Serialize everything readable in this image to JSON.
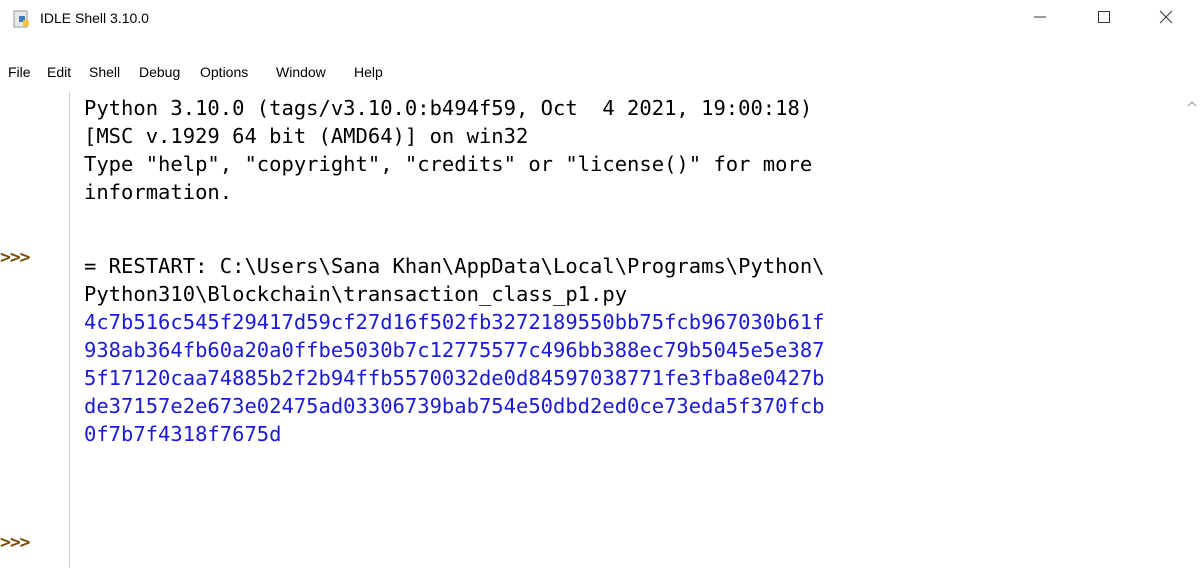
{
  "window": {
    "title": "IDLE Shell 3.10.0",
    "minimize_icon": "minimize-icon",
    "maximize_icon": "maximize-icon",
    "close_icon": "close-icon"
  },
  "menu": {
    "items": [
      "File",
      "Edit",
      "Shell",
      "Debug",
      "Options",
      "Window",
      "Help"
    ]
  },
  "prompts": [
    ">>>",
    ">>>"
  ],
  "shell_output": {
    "header_lines": [
      "Python 3.10.0 (tags/v3.10.0:b494f59, Oct  4 2021, 19:00:18)",
      "[MSC v.1929 64 bit (AMD64)] on win32",
      "Type \"help\", \"copyright\", \"credits\" or \"license()\" for more",
      "information."
    ],
    "restart_lines": [
      "= RESTART: C:\\Users\\Sana Khan\\AppData\\Local\\Programs\\Python\\",
      "Python310\\Blockchain\\transaction_class_p1.py"
    ],
    "output_lines": [
      "4c7b516c545f29417d59cf27d16f502fb3272189550bb75fcb967030b61f",
      "938ab364fb60a20a0ffbe5030b7c12775577c496bb388ec79b5045e5e387",
      "5f17120caa74885b2f2b94ffb5570032de0d84597038771fe3fba8e0427b",
      "de37157e2e673e02475ad03306739bab754e50dbd2ed0ce73eda5f370fcb",
      "0f7b7f4318f7675d"
    ]
  },
  "colors": {
    "stdout": "#1a1ad8",
    "prompt": "#7a4a00",
    "text": "#000000"
  }
}
